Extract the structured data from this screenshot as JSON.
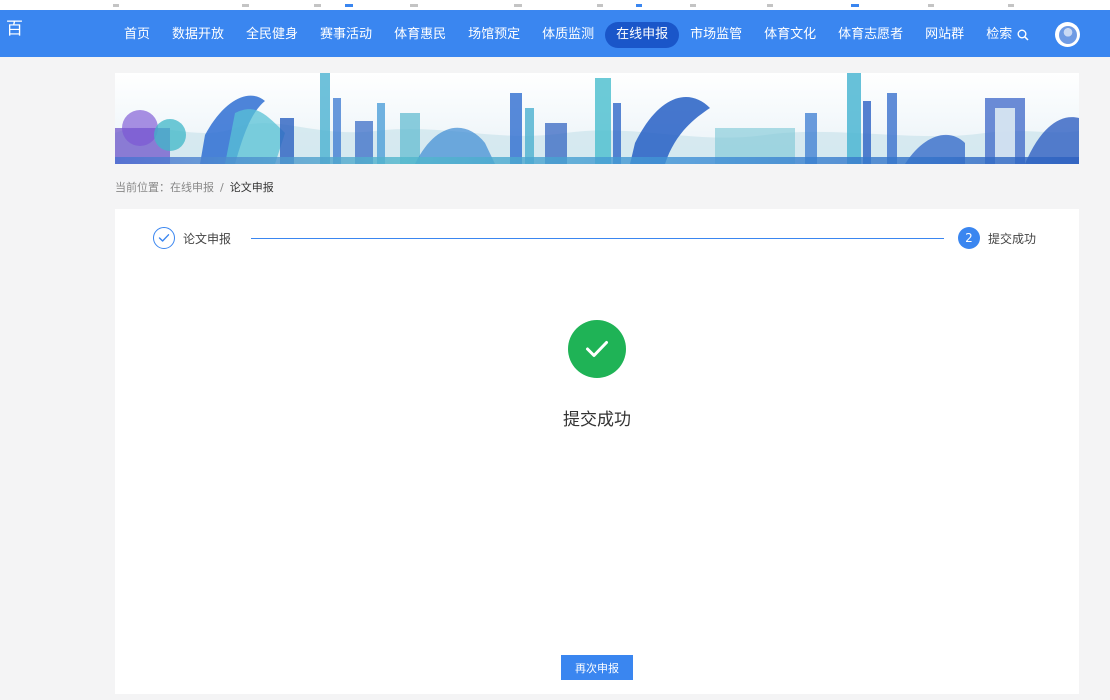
{
  "nav": {
    "items": [
      "首页",
      "数据开放",
      "全民健身",
      "赛事活动",
      "体育惠民",
      "场馆预定",
      "体质监测",
      "在线申报",
      "市场监管",
      "体育文化",
      "体育志愿者",
      "网站群"
    ],
    "active_index": 7,
    "search_label": "检索"
  },
  "header": {
    "edge_glyph": "百"
  },
  "breadcrumb": {
    "prefix": "当前位置：",
    "parent": "在线申报",
    "separator": "/",
    "current": "论文申报"
  },
  "steps": [
    {
      "label": "论文申报",
      "status": "done"
    },
    {
      "number": "2",
      "label": "提交成功",
      "status": "current"
    }
  ],
  "result": {
    "title": "提交成功"
  },
  "actions": {
    "resubmit_label": "再次申报"
  },
  "colors": {
    "primary": "#3a86f0",
    "active_nav": "#1a56c9",
    "success": "#1fb356"
  },
  "icons": {
    "search": "search-icon",
    "done": "check-icon",
    "success": "check-circle-icon",
    "avatar": "avatar"
  }
}
